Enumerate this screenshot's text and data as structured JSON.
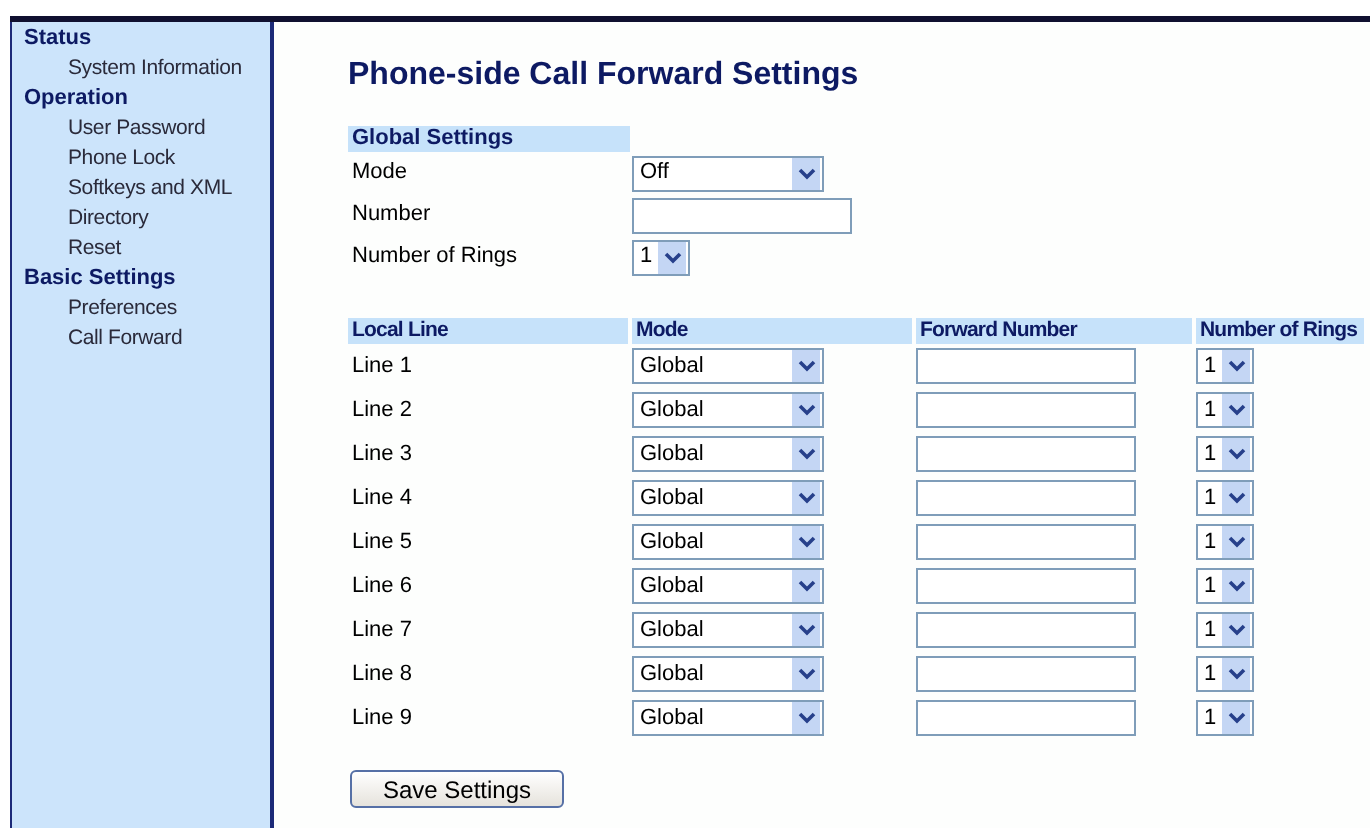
{
  "sidebar": {
    "groups": [
      {
        "label": "Status",
        "children": [
          {
            "label": "System Information"
          }
        ]
      },
      {
        "label": "Operation",
        "children": [
          {
            "label": "User Password"
          },
          {
            "label": "Phone Lock"
          },
          {
            "label": "Softkeys and XML"
          },
          {
            "label": "Directory"
          },
          {
            "label": "Reset"
          }
        ]
      },
      {
        "label": "Basic Settings",
        "children": [
          {
            "label": "Preferences"
          },
          {
            "label": "Call Forward"
          }
        ]
      }
    ]
  },
  "title": "Phone-side Call Forward Settings",
  "global_settings": {
    "heading": "Global Settings",
    "fields": [
      {
        "kind": "select",
        "label": "Mode",
        "value": "Off"
      },
      {
        "kind": "input",
        "label": "Number"
      },
      {
        "kind": "small-select",
        "label": "Number of Rings",
        "value": "1"
      }
    ]
  },
  "lines_table": {
    "columns": [
      "Local Line",
      "Mode",
      "Forward Number",
      "Number of Rings"
    ],
    "rows": [
      {
        "line": "Line 1",
        "mode": "Global",
        "rings": "1"
      },
      {
        "line": "Line 2",
        "mode": "Global",
        "rings": "1"
      },
      {
        "line": "Line 3",
        "mode": "Global",
        "rings": "1"
      },
      {
        "line": "Line 4",
        "mode": "Global",
        "rings": "1"
      },
      {
        "line": "Line 5",
        "mode": "Global",
        "rings": "1"
      },
      {
        "line": "Line 6",
        "mode": "Global",
        "rings": "1"
      },
      {
        "line": "Line 7",
        "mode": "Global",
        "rings": "1"
      },
      {
        "line": "Line 8",
        "mode": "Global",
        "rings": "1"
      },
      {
        "line": "Line 9",
        "mode": "Global",
        "rings": "1"
      }
    ]
  },
  "save_button": "Save Settings"
}
